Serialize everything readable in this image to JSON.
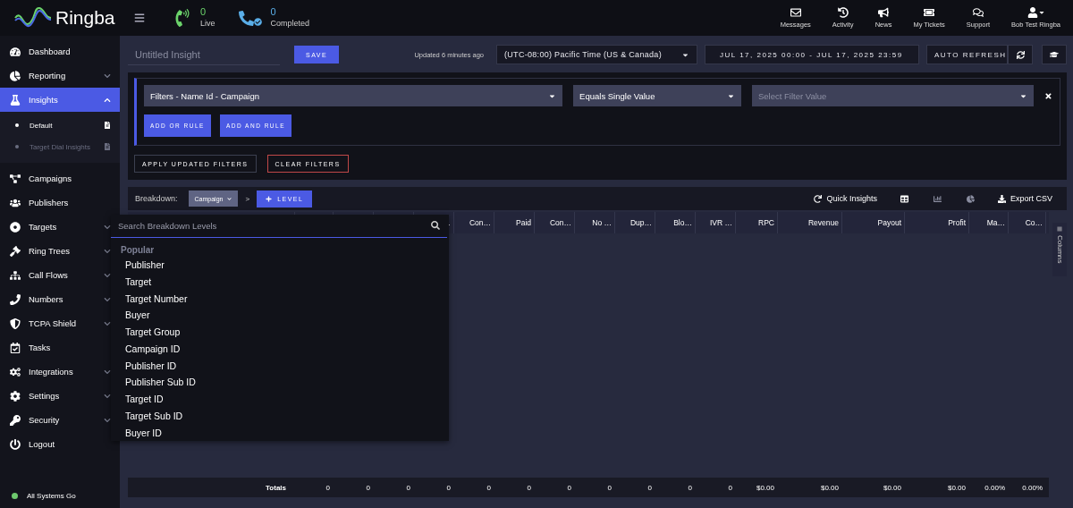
{
  "header": {
    "logo_text": "Ringba",
    "stats": [
      {
        "kind": "live",
        "count": "0",
        "label": "Live"
      },
      {
        "kind": "completed",
        "count": "0",
        "label": "Completed"
      }
    ],
    "nav": [
      "Messages",
      "Activity",
      "News",
      "My Tickets",
      "Support"
    ],
    "user": "Bob Test Ringba"
  },
  "sidebar": {
    "items": [
      {
        "kind": "link",
        "label": "Dashboard",
        "selected": false
      },
      {
        "kind": "group",
        "label": "Reporting",
        "selected": false,
        "expanded": false
      },
      {
        "kind": "group",
        "label": "Insights",
        "selected": true,
        "expanded": true,
        "children": [
          {
            "label": "Default",
            "selected": true
          },
          {
            "label": "Target Dial Insights",
            "selected": false
          }
        ]
      },
      {
        "kind": "link",
        "label": "Campaigns",
        "selected": false
      },
      {
        "kind": "link",
        "label": "Publishers",
        "selected": false
      },
      {
        "kind": "group",
        "label": "Targets",
        "selected": false,
        "expanded": false
      },
      {
        "kind": "group",
        "label": "Ring Trees",
        "selected": false,
        "expanded": false
      },
      {
        "kind": "group",
        "label": "Call Flows",
        "selected": false,
        "expanded": false
      },
      {
        "kind": "group",
        "label": "Numbers",
        "selected": false,
        "expanded": false
      },
      {
        "kind": "group",
        "label": "TCPA Shield",
        "selected": false,
        "expanded": false
      },
      {
        "kind": "link",
        "label": "Tasks",
        "selected": false
      },
      {
        "kind": "group",
        "label": "Integrations",
        "selected": false,
        "expanded": false
      },
      {
        "kind": "group",
        "label": "Settings",
        "selected": false,
        "expanded": false
      },
      {
        "kind": "group",
        "label": "Security",
        "selected": false,
        "expanded": false
      },
      {
        "kind": "link",
        "label": "Logout",
        "selected": false
      }
    ],
    "status": "All Systems Go"
  },
  "toolbar": {
    "insight_name": {
      "placeholder": "Untitled Insight"
    },
    "save": "SAVE",
    "updated": "Updated 6 minutes ago",
    "timezone": "(UTC-08:00) Pacific Time (US & Canada)",
    "date_range": "JUL 17, 2025 00:00 - JUL 17, 2025 23:59",
    "auto_refresh": "AUTO REFRESH"
  },
  "filters": {
    "rules": [
      {
        "field": "Filters - Name Id - Campaign",
        "operator": "Equals Single Value",
        "value": {
          "placeholder": "Select Filter Value"
        }
      }
    ],
    "add_or_rule": "ADD OR RULE",
    "add_and_rule": "ADD AND RULE",
    "apply": "APPLY UPDATED FILTERS",
    "clear": "CLEAR FILTERS"
  },
  "breakdown": {
    "label": "Breakdown:",
    "levels": [
      "Campaign"
    ],
    "separator": ">",
    "add_level": "LEVEL",
    "quick_insights": "Quick Insights",
    "views": [
      {
        "selected": true
      },
      {
        "selected": false
      },
      {
        "selected": false
      }
    ],
    "export": "Export CSV"
  },
  "level_menu": {
    "search": {
      "placeholder": "Search Breakdown Levels"
    },
    "groups": [
      {
        "title": "Popular",
        "items": [
          "Publisher",
          "Target",
          "Target Number",
          "Buyer",
          "Target Group",
          "Campaign ID",
          "Publisher ID",
          "Publisher Sub ID",
          "Target ID",
          "Target Sub ID",
          "Buyer ID"
        ]
      }
    ]
  },
  "table": {
    "columns": [
      "…",
      "Con…",
      "Paid",
      "Con…",
      "No …",
      "Dup…",
      "Blo…",
      "IVR …",
      "RPC",
      "Revenue",
      "Payout",
      "Profit",
      "Ma…",
      "Co…"
    ],
    "totals": {
      "label": "Totals",
      "values": [
        "0",
        "0",
        "0",
        "0",
        "0",
        "0",
        "0",
        "0",
        "0",
        "0",
        "0",
        "$0.00",
        "$0.00",
        "$0.00",
        "$0.00",
        "0.00%",
        "0.00%"
      ]
    },
    "side_tab": "Columns"
  }
}
